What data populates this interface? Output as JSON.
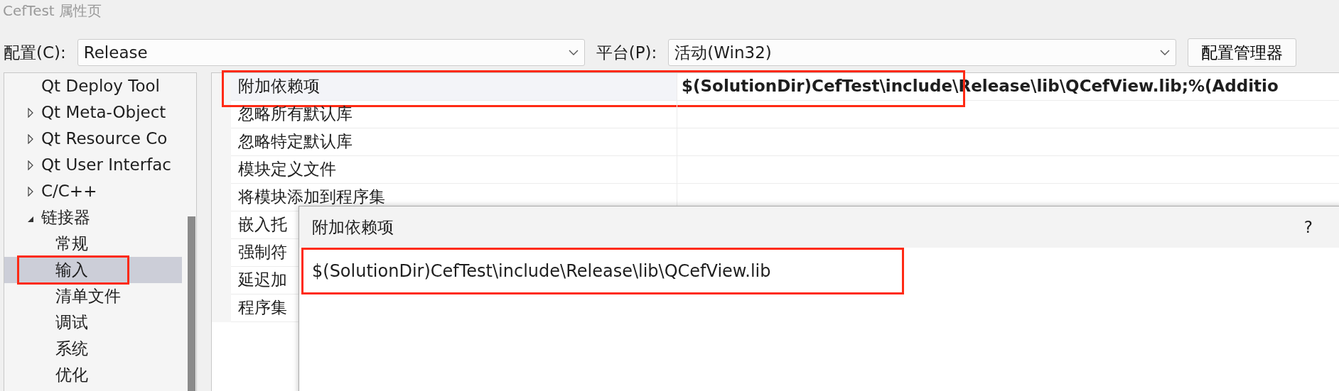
{
  "window": {
    "title": "CefTest 属性页"
  },
  "toolbar": {
    "configuration_label": "配置(C):",
    "configuration_value": "Release",
    "platform_label": "平台(P):",
    "platform_value": "活动(Win32)",
    "manager_button": "配置管理器"
  },
  "tree": [
    {
      "label": "Qt Deploy Tool",
      "selected": false
    },
    {
      "label": "Qt Meta-Object",
      "expanded": false,
      "selected": false
    },
    {
      "label": "Qt Resource Co",
      "expanded": false,
      "selected": false
    },
    {
      "label": "Qt User Interfac",
      "expanded": false,
      "selected": false
    },
    {
      "label": "C/C++",
      "expanded": false,
      "selected": false
    },
    {
      "label": "链接器",
      "expanded": true,
      "selected": false,
      "children": [
        {
          "label": "常规",
          "selected": false
        },
        {
          "label": "输入",
          "selected": true,
          "annotated": true
        },
        {
          "label": "清单文件",
          "selected": false
        },
        {
          "label": "调试",
          "selected": false
        },
        {
          "label": "系统",
          "selected": false
        },
        {
          "label": "优化",
          "selected": false
        }
      ]
    }
  ],
  "properties": [
    {
      "name": "附加依赖项",
      "value": "$(SolutionDir)CefTest\\include\\Release\\lib\\QCefView.lib;%(Additio",
      "modified": true,
      "selected": true,
      "annotated": true
    },
    {
      "name": "忽略所有默认库",
      "selected": false
    },
    {
      "name": "忽略特定默认库",
      "selected": false
    },
    {
      "name": "模块定义文件",
      "selected": false
    },
    {
      "name": "将模块添加到程序集",
      "selected": false
    },
    {
      "name": "嵌入托",
      "selected": false
    },
    {
      "name": "强制符",
      "selected": false
    },
    {
      "name": "延迟加",
      "selected": false
    },
    {
      "name": "程序集",
      "selected": false
    }
  ],
  "dialog": {
    "title": "附加依赖项",
    "help": "?",
    "lines": [
      "$(SolutionDir)CefTest\\include\\Release\\lib\\QCefView.lib"
    ],
    "annotated": true
  }
}
